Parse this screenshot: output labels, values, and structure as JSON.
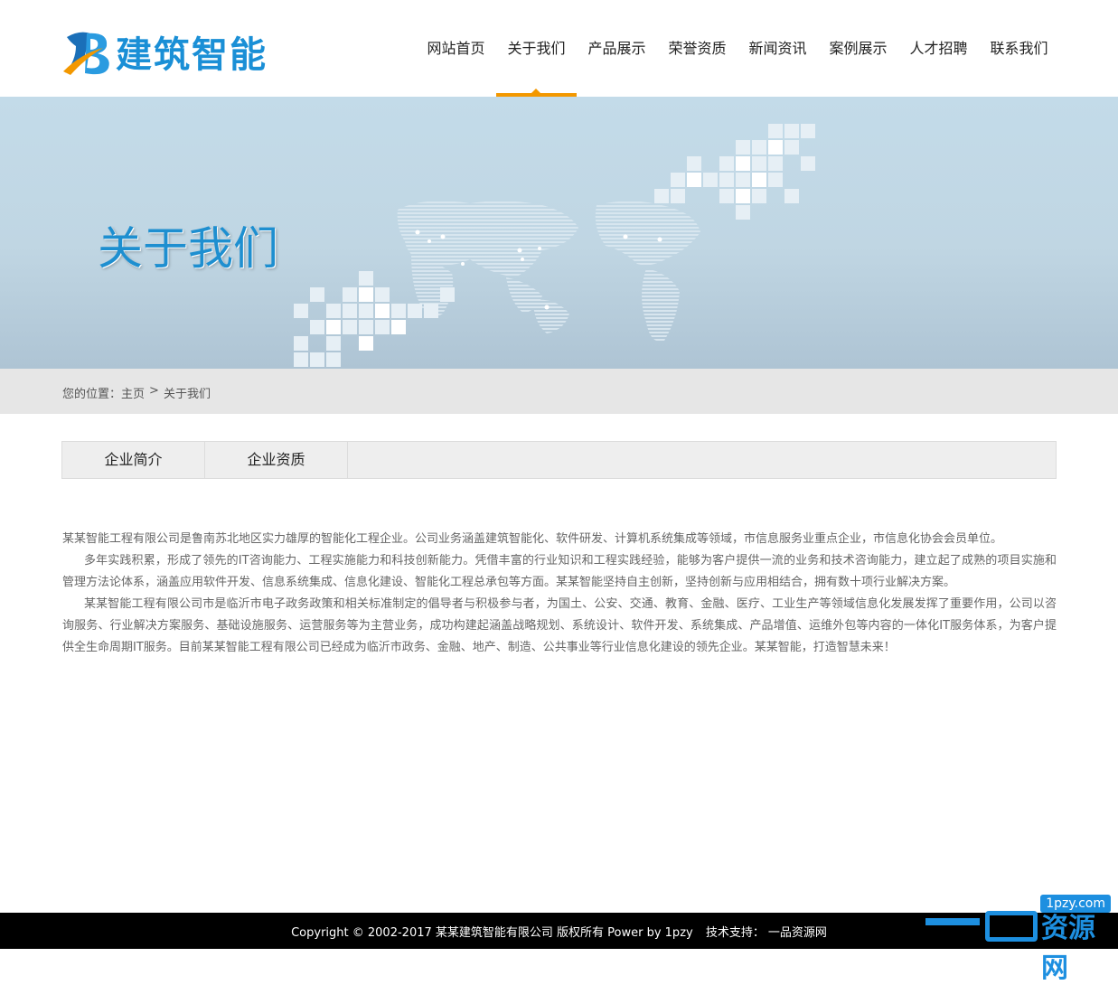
{
  "brand": {
    "logo_text": "建筑智能",
    "logo_letter": "B",
    "colors": {
      "primary": "#1a8fd6",
      "accent": "#f39800"
    }
  },
  "nav": {
    "items": [
      {
        "label": "网站首页",
        "active": false
      },
      {
        "label": "关于我们",
        "active": true
      },
      {
        "label": "产品展示",
        "active": false
      },
      {
        "label": "荣誉资质",
        "active": false
      },
      {
        "label": "新闻资讯",
        "active": false
      },
      {
        "label": "案例展示",
        "active": false
      },
      {
        "label": "人才招聘",
        "active": false
      },
      {
        "label": "联系我们",
        "active": false
      }
    ]
  },
  "banner": {
    "title": "关于我们"
  },
  "breadcrumb": {
    "prefix": "您的位置：",
    "home": "主页",
    "separator": ">",
    "current": "关于我们"
  },
  "tabs": [
    {
      "label": "企业简介"
    },
    {
      "label": "企业资质"
    }
  ],
  "content": {
    "paragraphs": [
      "某某智能工程有限公司是鲁南苏北地区实力雄厚的智能化工程企业。公司业务涵盖建筑智能化、软件研发、计算机系统集成等领域，市信息服务业重点企业，市信息化协会会员单位。",
      "多年实践积累，形成了领先的IT咨询能力、工程实施能力和科技创新能力。凭借丰富的行业知识和工程实践经验，能够为客户提供一流的业务和技术咨询能力，建立起了成熟的项目实施和管理方法论体系，涵盖应用软件开发、信息系统集成、信息化建设、智能化工程总承包等方面。某某智能坚持自主创新，坚持创新与应用相结合，拥有数十项行业解决方案。",
      "某某智能工程有限公司市是临沂市电子政务政策和相关标准制定的倡导者与积极参与者，为国土、公安、交通、教育、金融、医疗、工业生产等领域信息化发展发挥了重要作用，公司以咨询服务、行业解决方案服务、基础设施服务、运营服务等为主营业务，成功构建起涵盖战略规划、系统设计、软件开发、系统集成、产品增值、运维外包等内容的一体化IT服务体系，为客户提供全生命周期IT服务。目前某某智能工程有限公司已经成为临沂市政务、金融、地产、制造、公共事业等行业信息化建设的领先企业。某某智能，打造智慧未来！"
    ]
  },
  "footer": {
    "copyright": "Copyright © 2002-2017 某某建筑智能有限公司 版权所有 Power by 1pzy",
    "support_label": "技术支持：",
    "support_name": "一品资源网"
  },
  "watermark": {
    "url": "1pzy.com",
    "text": "资源网"
  }
}
